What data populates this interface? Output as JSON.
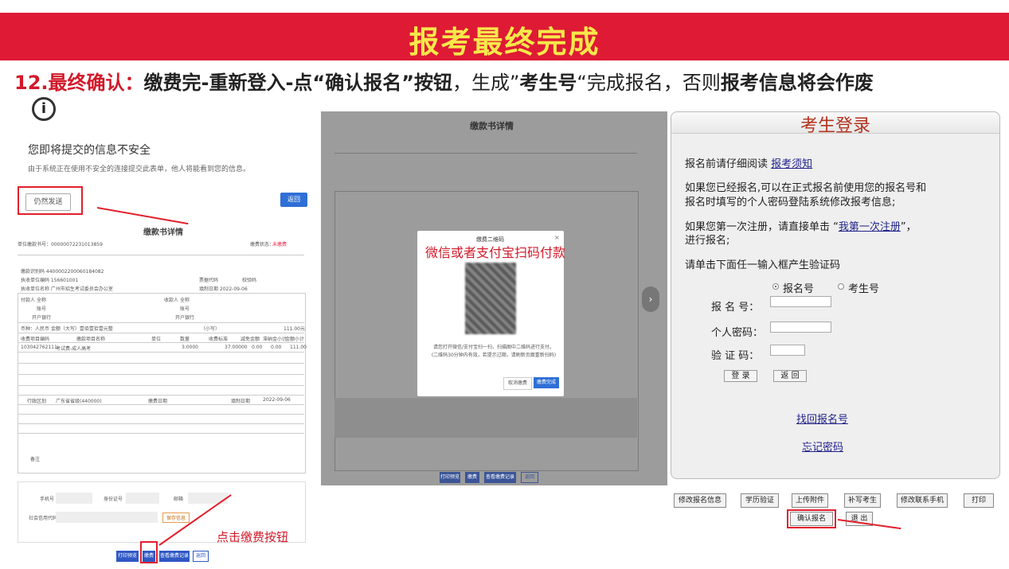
{
  "header": {
    "title": "报考最终完成"
  },
  "instruction": {
    "step": "12.最终确认：",
    "part1": "缴费完-重新登入-点“确认报名”按钮",
    "part2": "，生成”",
    "part3": "考生号",
    "part4": "“完成报名，否则",
    "part5": "报考信息将会作废"
  },
  "left": {
    "warning_title": "您即将提交的信息不安全",
    "warning_desc": "由于系统正在使用不安全的连接提交此表单，他人将能看到您的信息。",
    "send_anyway": "仍然发送",
    "back": "返回",
    "doc_title": "缴款书详情",
    "doc_no": "单位缴款书号：0000007223101385​9",
    "doc_status": "缴费状态：",
    "status_badge": "未缴费",
    "fields": [
      "缴款识别码 440000220006018408​2",
      "执收单位编码 156601001",
      "执收单位名称 广州市招生考试委员会办公室",
      "票据代码",
      "校验码",
      "填制日期 2022-09-06"
    ],
    "payer_labels": [
      "付款人",
      "全称",
      "账号",
      "开户银行"
    ],
    "payee_labels": [
      "收款人",
      "全称",
      "账号",
      "开户银行"
    ],
    "currency_row": "币种：人民币 金额（大写）壹佰壹拾壹元整",
    "amount_small": "（小写）",
    "amount_total": "111.00元",
    "table_headers": [
      "收费项目编码",
      "缴款项目名称",
      "单位",
      "数量",
      "收费标准",
      "减免金额",
      "滞纳金小计",
      "金额小计"
    ],
    "table_row": [
      "103042762111",
      "考试费-成人高考",
      "",
      "3.0000",
      "37.00000",
      "0.00",
      "0.00",
      "111.00"
    ],
    "region_label": "行政区划",
    "region_value": "广东省省级(440000)",
    "pay_date_label": "缴费日期",
    "fill_date_label": "填制日期",
    "fill_date_value": "2022-09-06",
    "remark": "备注",
    "phone_label": "手机号",
    "id_label": "身份证号",
    "mail_label": "邮箱",
    "credit_label": "社会信用代码",
    "save_info": "保存信息",
    "buttons": [
      "打印预览",
      "缴费",
      "查看缴费记录",
      "返回"
    ],
    "annotation": "点击缴费按钮"
  },
  "middle": {
    "title": "缴款书详情",
    "modal_header": "缴费二维码",
    "modal_close": "×",
    "modal_red": "微信或者支付宝扫码付款",
    "modal_text": "请您打开微信/支付宝扫一扫，扫描图中二维码进行支付。(二维码30分钟内有效，若提示过期，请刷新页面重新扫码)",
    "cancel": "取消缴费",
    "done": "缴费完成",
    "buttons": [
      "打印预览",
      "缴费",
      "查看缴费记录",
      "返回"
    ]
  },
  "login": {
    "title": "考生登录",
    "line1": "报名前请仔细阅读",
    "link1": "报考须知",
    "line2": "如果您已经报名,可以在正式报名前使用您的报名号和",
    "line3": "报名时填写的个人密码登陆系统修改报考信息;",
    "line4a": "如果您第一次注册，请直接单击 “",
    "link2": "我第一次注册",
    "line4b": "”，",
    "line5": "进行报名;",
    "line6": "请单击下面任一输入框产生验证码",
    "radio1": "报名号",
    "radio2": "考生号",
    "label_no": "报 名 号：",
    "label_pwd": "个人密码：",
    "label_code": "验 证 码：",
    "btn_login": "登 录",
    "btn_back": "返 回",
    "find_no": "找回报名号",
    "forgot_pwd": "忘记密码"
  },
  "bottom_bar": {
    "buttons": [
      "修改报名信息",
      "学历验证",
      "上传附件",
      "补写考生",
      "修改联系手机",
      "打印"
    ],
    "confirm": "确认报名",
    "exit": "退 出"
  },
  "colors": {
    "banner": "#de1a35",
    "banner_text": "#f7e84a",
    "accent_red": "#d11a2a",
    "link_blue": "#22238a",
    "button_blue": "#2f6fd6"
  }
}
